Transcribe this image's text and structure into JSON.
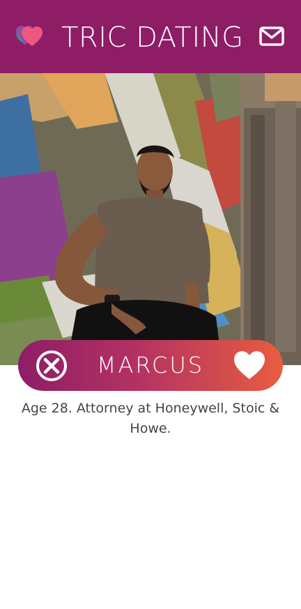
{
  "header": {
    "logo_icon": "hearts-logo-icon",
    "title": "TRIC DATING",
    "mail_icon": "envelope-icon",
    "background_color": "#8e1d66"
  },
  "profile": {
    "photo_description_icon": "profile-photo",
    "name": "MARCUS",
    "bio": "Age 28. Attorney at Honeywell, Stoic & Howe.",
    "dismiss_icon": "close-circle-icon",
    "like_icon": "heart-icon"
  },
  "colors": {
    "brand": "#8e1d66",
    "gradient_start": "#8e1d66",
    "gradient_end": "#e85d40",
    "text": "#444444"
  }
}
